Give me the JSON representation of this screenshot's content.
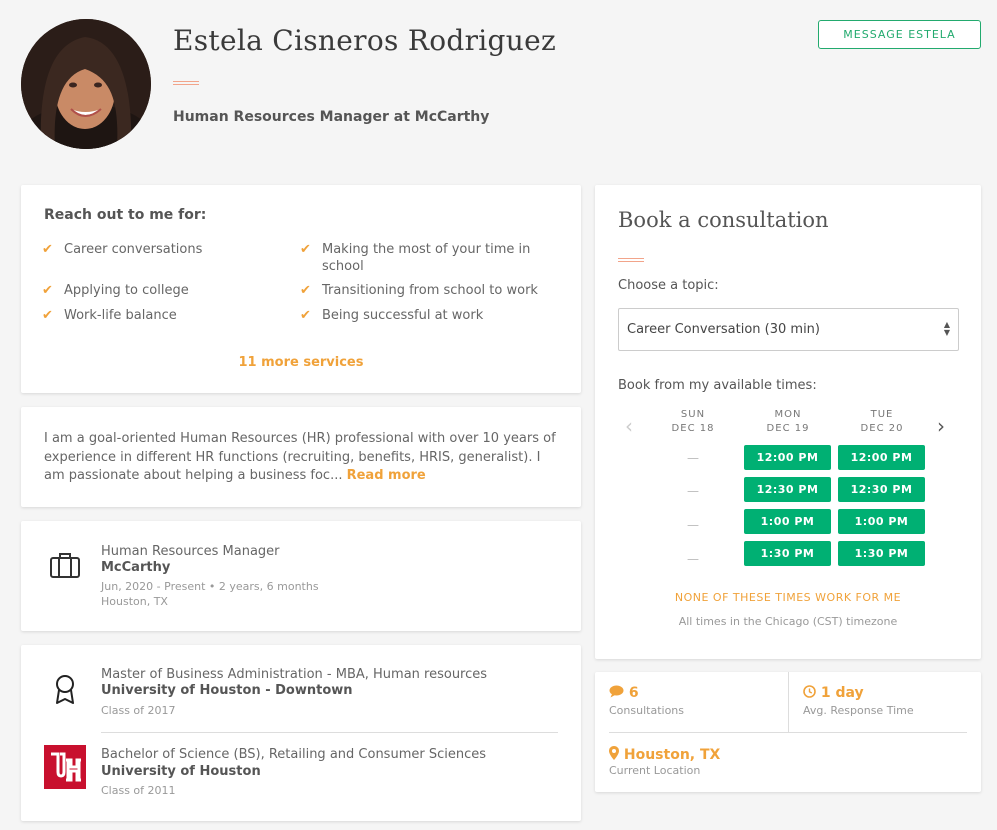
{
  "profile": {
    "name": "Estela Cisneros Rodriguez",
    "headline": "Human Resources Manager at McCarthy",
    "message_button": "MESSAGE ESTELA"
  },
  "services": {
    "title": "Reach out to me for:",
    "items": [
      "Career conversations",
      "Making the most of your time in school",
      "Applying to college",
      "Transitioning from school to work",
      "Work-life balance",
      "Being successful at work"
    ],
    "more_link": "11 more services"
  },
  "about": {
    "text": "I am a goal-oriented Human Resources (HR) professional with over 10 years of experience in different HR functions (recruiting, benefits, HRIS, generalist). I am passionate about helping a business foc...",
    "read_more": "Read more"
  },
  "experience": {
    "title": "Human Resources Manager",
    "company": "McCarthy",
    "dates": "Jun, 2020 - Present • 2 years, 6 months",
    "location": "Houston, TX"
  },
  "education": [
    {
      "degree": "Master of Business Administration - MBA, Human resources",
      "school": "University of Houston - Downtown",
      "class": "Class of 2017"
    },
    {
      "degree": "Bachelor of Science (BS), Retailing and Consumer Sciences",
      "school": "University of Houston",
      "class": "Class of 2011"
    }
  ],
  "booking": {
    "title": "Book a consultation",
    "choose_label": "Choose a topic:",
    "selected_topic": "Career Conversation (30 min)",
    "available_label": "Book from my available times:",
    "days": [
      {
        "name": "SUN",
        "date": "DEC 18",
        "slots": [
          "—",
          "—",
          "—",
          "—"
        ]
      },
      {
        "name": "MON",
        "date": "DEC 19",
        "slots": [
          "12:00 PM",
          "12:30 PM",
          "1:00 PM",
          "1:30 PM"
        ]
      },
      {
        "name": "TUE",
        "date": "DEC 20",
        "slots": [
          "12:00 PM",
          "12:30 PM",
          "1:00 PM",
          "1:30 PM"
        ]
      }
    ],
    "none_link": "NONE OF THESE TIMES WORK FOR ME",
    "timezone_note": "All times in the Chicago (CST) timezone"
  },
  "stats": {
    "consultations_value": "6",
    "consultations_label": "Consultations",
    "response_value": "1 day",
    "response_label": "Avg. Response Time",
    "location_value": "Houston, TX",
    "location_label": "Current Location"
  },
  "colors": {
    "accent": "#f0a23a",
    "green": "#00b073",
    "brand_green_border": "#22aa6e",
    "accent_bar": "#f2a48a",
    "uh_red": "#c8102e"
  }
}
